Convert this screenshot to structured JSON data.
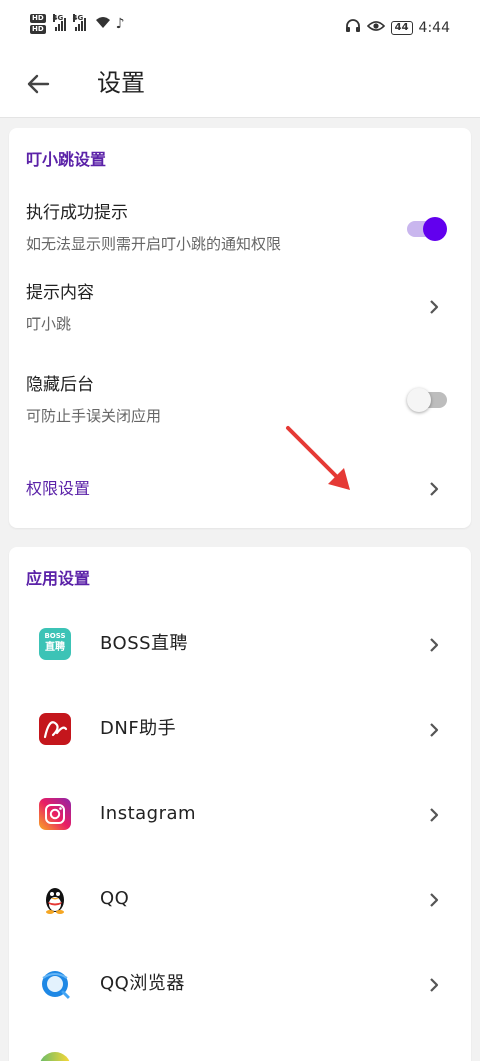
{
  "status_bar": {
    "hd1": "HD",
    "hd2": "HD",
    "net1": "4G",
    "net2": "4G",
    "battery": "44",
    "time": "4:44"
  },
  "app_bar": {
    "title": "设置",
    "back_icon": "arrow-left-icon"
  },
  "section1": {
    "title": "叮小跳设置",
    "rows": [
      {
        "title": "执行成功提示",
        "subtitle": "如无法显示则需开启叮小跳的通知权限",
        "toggle_on": true
      },
      {
        "title": "提示内容",
        "subtitle": "叮小跳"
      },
      {
        "title": "隐藏后台",
        "subtitle": "可防止手误关闭应用",
        "toggle_on": false
      },
      {
        "title": "权限设置"
      }
    ]
  },
  "section2": {
    "title": "应用设置",
    "apps": [
      {
        "name": "BOSS直聘",
        "icon": "boss-zhipin-icon",
        "icon_text_top": "BOSS",
        "icon_text_bottom": "直聘"
      },
      {
        "name": "DNF助手",
        "icon": "dnf-assistant-icon"
      },
      {
        "name": "Instagram",
        "icon": "instagram-icon"
      },
      {
        "name": "QQ",
        "icon": "qq-penguin-icon"
      },
      {
        "name": "QQ浏览器",
        "icon": "qq-browser-icon"
      }
    ]
  },
  "colors": {
    "accent": "#5b22a8",
    "toggle_on": "#6200ee",
    "annotation_arrow": "#e53935"
  }
}
